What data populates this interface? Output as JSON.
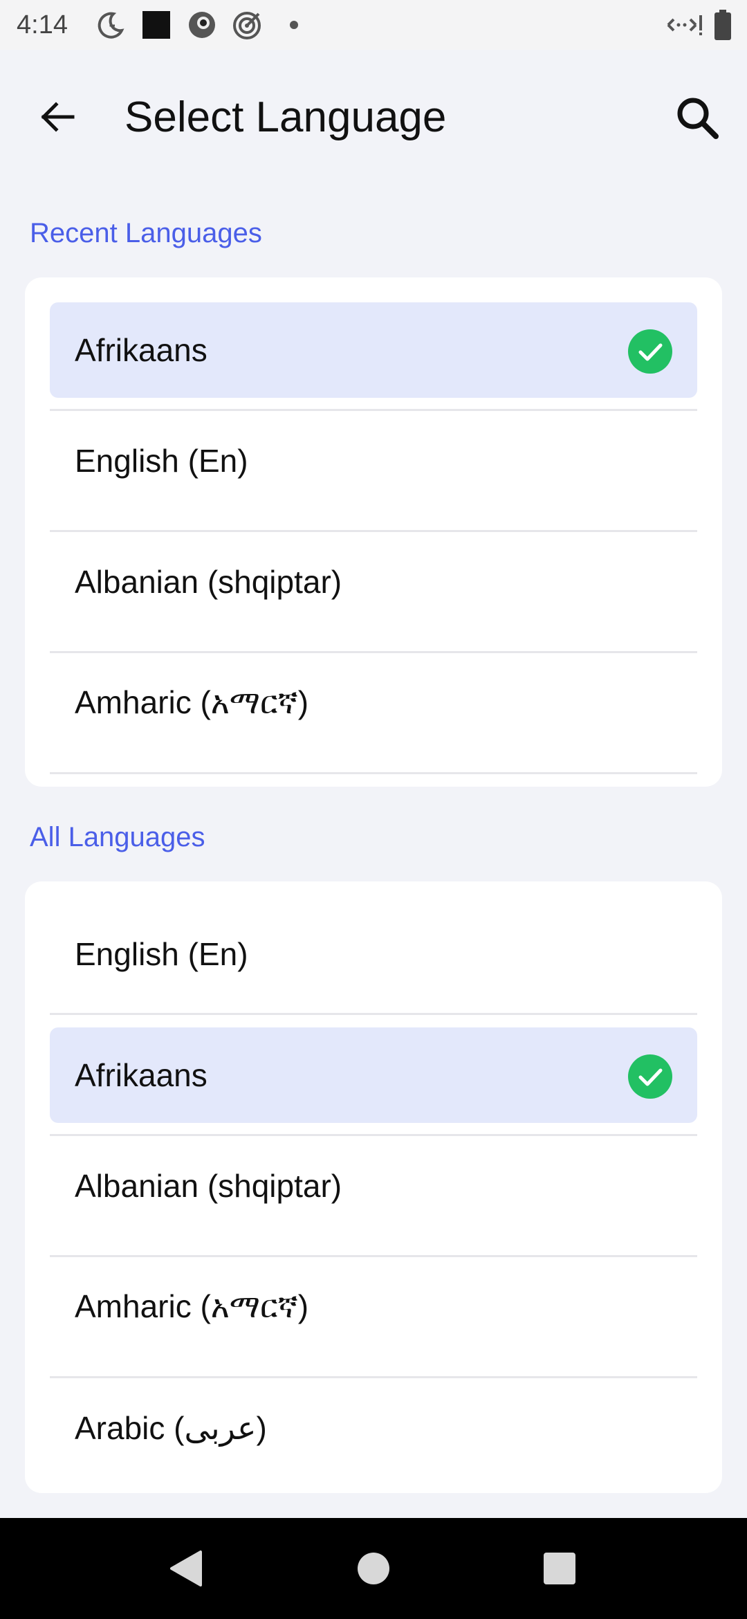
{
  "status_bar": {
    "time": "4:14"
  },
  "header": {
    "title": "Select Language",
    "back_icon": "arrow-left-icon",
    "search_icon": "search-icon"
  },
  "recent": {
    "heading": "Recent Languages",
    "items": [
      {
        "label": "Afrikaans",
        "selected": true
      },
      {
        "label": "English (En)",
        "selected": false
      },
      {
        "label": "Albanian (shqiptar)",
        "selected": false
      },
      {
        "label": "Amharic (አማርኛ)",
        "selected": false
      }
    ]
  },
  "all": {
    "heading": "All Languages",
    "items": [
      {
        "label": "English (En)",
        "selected": false
      },
      {
        "label": "Afrikaans",
        "selected": true
      },
      {
        "label": "Albanian (shqiptar)",
        "selected": false
      },
      {
        "label": "Amharic (አማርኛ)",
        "selected": false
      },
      {
        "label": "Arabic (عربى)",
        "selected": false
      }
    ]
  },
  "colors": {
    "accent": "#4a5ee8",
    "selected_bg": "#e3e8fb",
    "check": "#22c063"
  }
}
